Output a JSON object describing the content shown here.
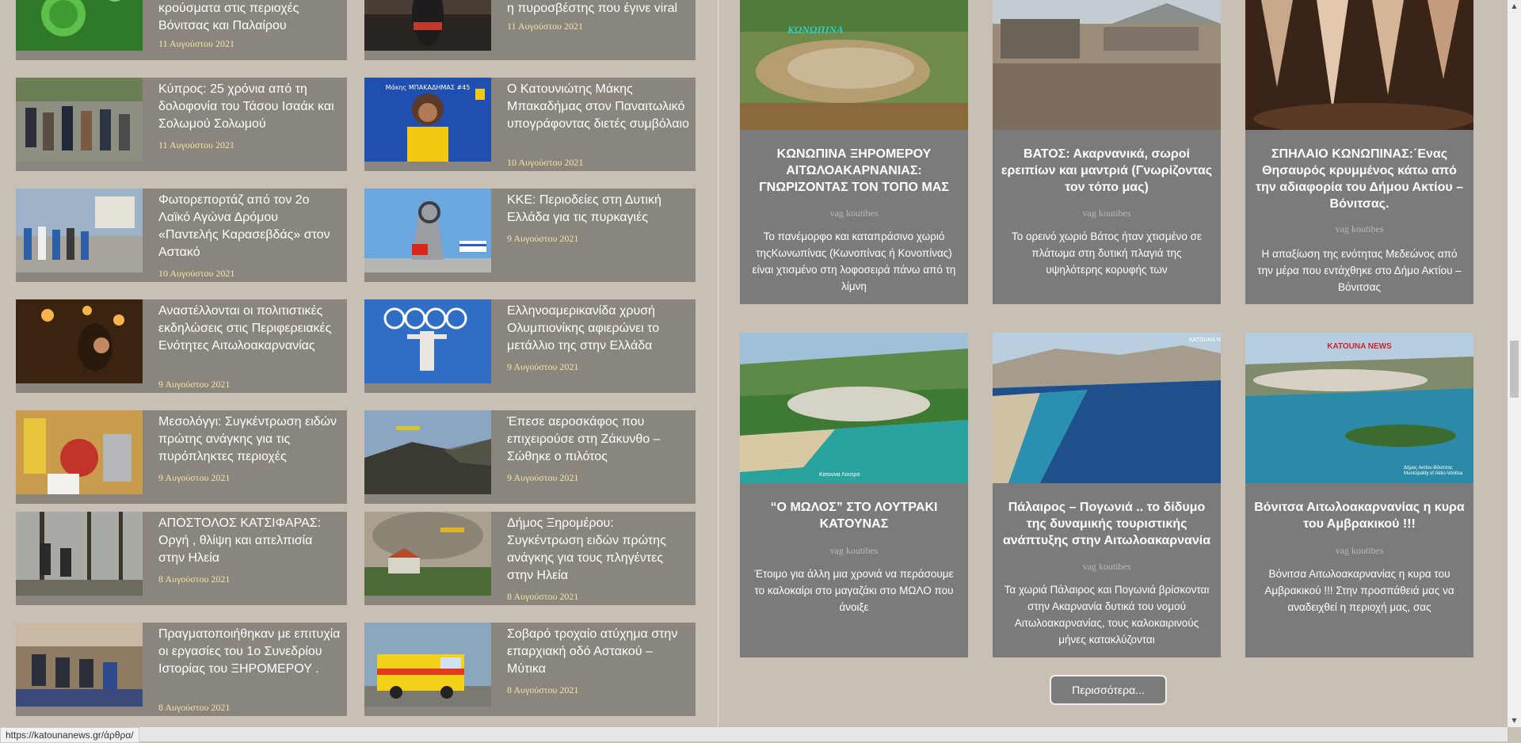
{
  "left_news": [
    {
      "title": "κρούσματα στις περιοχές Βόνιτσας και Παλαίρου",
      "date": "11 Αυγούστου 2021"
    },
    {
      "title": "η πυροσβέστης που έγινε viral",
      "date": "11 Αυγούστου 2021"
    },
    {
      "title": "Κύπρος: 25 χρόνια από τη δολοφονία του Τάσου Ισαάκ και Σολωμού Σολωμού",
      "date": "11 Αυγούστου 2021"
    },
    {
      "title": "Ο Κατουνιώτης Μάκης Μπακαδήμας στον Παναιτωλικό υπογράφοντας διετές συμβόλαιο",
      "date": "10 Αυγούστου 2021",
      "thumb_text": "Μάκης ΜΠΑΚΑΔΗΜΑΣ #45"
    },
    {
      "title": "Φωτορεπορτάζ από τον 2ο Λαϊκό Αγώνα Δρόμου «Παντελής Καρασεβδάς» στον Αστακό",
      "date": "10 Αυγούστου 2021"
    },
    {
      "title": "ΚΚΕ: Περιοδείες στη Δυτική Ελλάδα για τις πυρκαγιές",
      "date": "9 Αυγούστου 2021"
    },
    {
      "title": "Αναστέλλονται οι πολιτιστικές εκδηλώσεις στις Περιφερειακές Ενότητες Αιτωλοακαρνανίας",
      "date": "9 Αυγούστου 2021"
    },
    {
      "title": "Ελληνοαμερικανίδα χρυσή Ολυμπιονίκης αφιερώνει το μετάλλιο της στην Ελλάδα",
      "date": "9 Αυγούστου 2021"
    },
    {
      "title": "Μεσολόγγι: Συγκέντρωση ειδών πρώτης ανάγκης για τις πυρόπληκτες περιοχές",
      "date": "9 Αυγούστου 2021"
    },
    {
      "title": "Έπεσε αεροσκάφος που επιχειρούσε στη Ζάκυνθο – Σώθηκε ο πιλότος",
      "date": "9 Αυγούστου 2021"
    },
    {
      "title": "ΑΠΟΣΤΟΛΟΣ ΚΑΤΣΙΦΑΡΑΣ: Οργή , θλίψη και απελπισία στην Ηλεία",
      "date": "8 Αυγούστου 2021"
    },
    {
      "title": "Δήμος Ξηρομέρου: Συγκέντρωση ειδών πρώτης ανάγκης για τους πληγέντες στην Ηλεία",
      "date": "8 Αυγούστου 2021"
    },
    {
      "title": "Πραγματοποιήθηκαν με επιτυχία οι εργασίες του 1ο Συνεδρίου Ιστορίας του ΞΗΡΟΜΕΡΟΥ .",
      "date": "8 Αυγούστου 2021"
    },
    {
      "title": "Σοβαρό τροχαίο ατύχημα στην επαρχιακή οδό Αστακού – Μύτικα",
      "date": "8 Αυγούστου 2021"
    }
  ],
  "cards": [
    {
      "title": "ΚΩΝΩΠΙΝΑ ΞΗΡΟΜΕΡΟΥ ΑΙΤΩΛΟΑΚΑΡΝΑΝΙΑΣ: ΓΝΩΡΙΖΟΝΤΑΣ ΤΟΝ ΤΟΠΟ ΜΑΣ",
      "author": "vag koutibes",
      "excerpt": "Το πανέμορφο και καταπράσινο χωριό τηςΚωνωπίνας (Κωνοπίνας ή Κονοπίνας) είναι χτισμένο στη λοφοσειρά πάνω από τη λίμνη",
      "image_caption": "ΚΩΝΩΠΙΝΑ"
    },
    {
      "title": "ΒΑΤΟΣ: Ακαρνανικά, σωροί ερειπίων και μαντριά (Γνωρίζοντας τον τόπο μας)",
      "author": "vag koutibes",
      "excerpt": "Το ορεινό χωριό Βάτος ήταν χτισμένο σε πλάτωμα στη δυτική πλαγιά της υψηλότερης κορυφής των"
    },
    {
      "title": "ΣΠΗΛΑΙΟ ΚΩΝΩΠΙΝΑΣ:΄Ενας Θησαυρός κρυμμένος κάτω από την αδιαφορία του Δήμου Ακτίου – Βόνιτσας.",
      "author": "vag koutibes",
      "excerpt": "Η απαξίωση της ενότητας Μεδεώνος από την μέρα που εντάχθηκε στο Δήμο Ακτίου – Βόνιτσας"
    },
    {
      "title": "“Ο ΜΩΛΟΣ” ΣΤΟ ΛΟΥΤΡΑΚΙ ΚΑΤΟΥΝΑΣ",
      "author": "vag koutibes",
      "excerpt": "Έτοιμο για άλλη μια χρονιά να περάσουμε το καλοκαίρι στο μαγαζάκι στο ΜΩΛΟ που άνοιξε",
      "image_caption": "Κατουνα Λουτρα"
    },
    {
      "title": "Πάλαιρος – Πογωνιά .. το δίδυμο της δυναμικής τουριστικής ανάπτυξης στην Αιτωλοακαρνανία",
      "author": "vag koutibes",
      "excerpt": "Τα χωριά Πάλαιρος και Πογωνιά βρίσκονται στην Ακαρνανία δυτικά του νομού Αιτωλοακαρνανίας, τους καλοκαιρινούς μήνες κατακλύζονται",
      "image_caption": "KATOUNA N"
    },
    {
      "title": "Βόνιτσα Αιτωλοακαρνανίας η κυρα του Αμβρακικού !!!",
      "author": "vag koutibes",
      "excerpt": "Βόνιτσα Αιτωλοακαρνανίας η κυρα του Αμβρακικού !!! Στην προσπάθειά μας να αναδειχθεί η περιοχή μας, σας",
      "image_caption": "KATOUNA NEWS",
      "image_caption2": "Δήμος Ακτίου-Βόνιτσας Municipality of Aktio-Vonitsa"
    }
  ],
  "more_button": "Περισσότερα...",
  "status_url": "https://katounanews.gr/άρθρα/",
  "colors": {
    "page_bg": "#c8c0b4",
    "news_bg": "#8a857d",
    "card_bg": "#7b7b7b",
    "date": "#f3e6a6"
  },
  "icons": {
    "scroll_up": "triangle-up-icon",
    "scroll_down": "triangle-down-icon"
  }
}
